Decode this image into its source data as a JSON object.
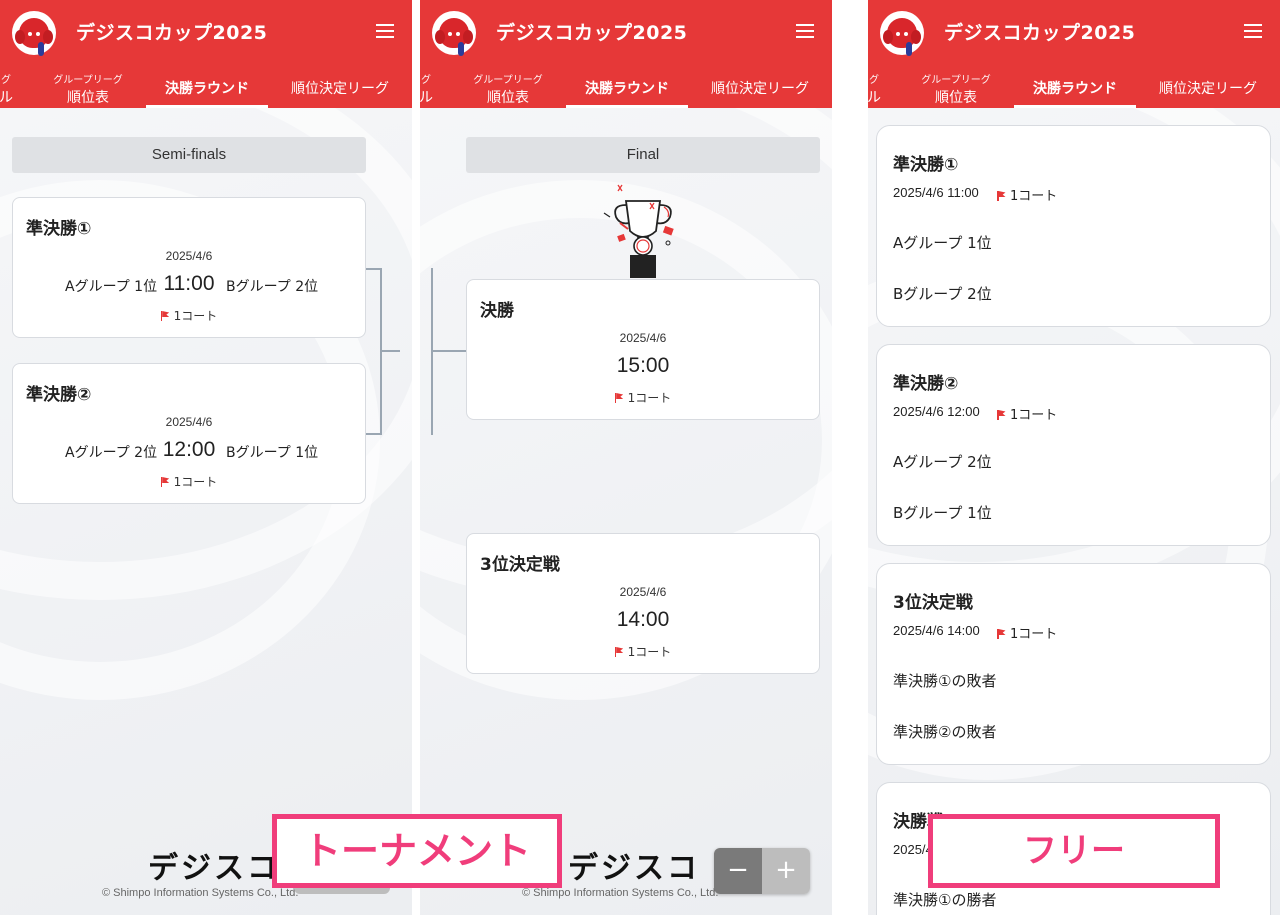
{
  "app": {
    "title": "デジスコカップ2025",
    "brand_color": "#e63838",
    "icons": {
      "menu": "hamburger-menu-icon",
      "logo": "elephant-mascot-logo",
      "court": "flag-icon",
      "trophy": "trophy-illustration"
    }
  },
  "tabs": {
    "cut_small": "グ",
    "cut_big": "ル",
    "group_small": "グループリーグ",
    "group_big": "順位表",
    "knockout": "決勝ラウンド",
    "placement": "順位決定リーグ"
  },
  "tournament_left": {
    "round_label": "Semi-finals",
    "matches": [
      {
        "name": "準決勝①",
        "date": "2025/4/6",
        "team_a": "Aグループ 1位",
        "time": "11:00",
        "team_b": "Bグループ 2位",
        "court": "1コート"
      },
      {
        "name": "準決勝②",
        "date": "2025/4/6",
        "team_a": "Aグループ 2位",
        "time": "12:00",
        "team_b": "Bグループ 1位",
        "court": "1コート"
      }
    ]
  },
  "tournament_center": {
    "round_label": "Final",
    "matches": [
      {
        "name": "決勝",
        "date": "2025/4/6",
        "time": "15:00",
        "court": "1コート"
      },
      {
        "name": "3位決定戦",
        "date": "2025/4/6",
        "time": "14:00",
        "court": "1コート"
      }
    ]
  },
  "free_view": {
    "matches": [
      {
        "name": "準決勝①",
        "datetime": "2025/4/6 11:00",
        "court": "1コート",
        "team_a": "Aグループ 1位",
        "team_b": "Bグループ 2位"
      },
      {
        "name": "準決勝②",
        "datetime": "2025/4/6 12:00",
        "court": "1コート",
        "team_a": "Aグループ 2位",
        "team_b": "Bグループ 1位"
      },
      {
        "name": "3位決定戦",
        "datetime": "2025/4/6 14:00",
        "court": "1コート",
        "team_a": "準決勝①の敗者",
        "team_b": "準決勝②の敗者"
      },
      {
        "name": "決勝戦",
        "datetime": "2025/4",
        "team_a": "準決勝①の勝者"
      }
    ]
  },
  "footer": {
    "logo_text": "デジスコ",
    "copyright": "© Shimpo Information Systems Co., Ltd."
  },
  "zoom": {
    "minus": "−",
    "plus": "+"
  },
  "captions": {
    "tournament": "トーナメント",
    "free": "フリー",
    "accent": "#f03d7b"
  }
}
